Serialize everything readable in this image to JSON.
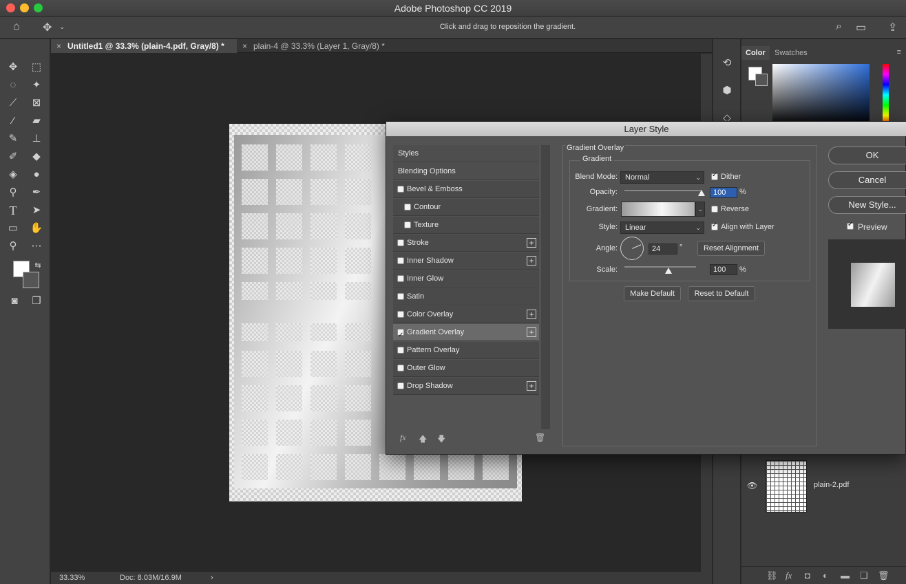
{
  "app": {
    "title": "Adobe Photoshop CC 2019"
  },
  "optionsbar": {
    "hint": "Click and drag to reposition the gradient."
  },
  "tabs": [
    {
      "label": "Untitled1 @ 33.3% (plain-4.pdf, Gray/8) *"
    },
    {
      "label": "plain-4 @ 33.3% (Layer 1, Gray/8) *"
    }
  ],
  "statusbar": {
    "zoom": "33.33%",
    "doc": "Doc: 8.03M/16.9M"
  },
  "color_panel": {
    "tabs": [
      "Color",
      "Swatches"
    ]
  },
  "layers": {
    "layer_name": "plain-2.pdf"
  },
  "dialog": {
    "title": "Layer Style",
    "styles": [
      {
        "label": "Styles",
        "header": true
      },
      {
        "label": "Blending Options",
        "header": true
      },
      {
        "label": "Bevel & Emboss",
        "checked": false
      },
      {
        "label": "Contour",
        "checked": false,
        "indent": true
      },
      {
        "label": "Texture",
        "checked": false,
        "indent": true
      },
      {
        "label": "Stroke",
        "checked": false,
        "plus": true
      },
      {
        "label": "Inner Shadow",
        "checked": false,
        "plus": true
      },
      {
        "label": "Inner Glow",
        "checked": false
      },
      {
        "label": "Satin",
        "checked": false
      },
      {
        "label": "Color Overlay",
        "checked": false,
        "plus": true
      },
      {
        "label": "Gradient Overlay",
        "checked": true,
        "plus": true,
        "selected": true
      },
      {
        "label": "Pattern Overlay",
        "checked": false
      },
      {
        "label": "Outer Glow",
        "checked": false
      },
      {
        "label": "Drop Shadow",
        "checked": false,
        "plus": true
      }
    ],
    "fx_label": "fx",
    "section_title": "Gradient Overlay",
    "group_title": "Gradient",
    "blend_mode_label": "Blend Mode:",
    "blend_mode": "Normal",
    "dither_label": "Dither",
    "dither": true,
    "opacity_label": "Opacity:",
    "opacity": "100",
    "opacity_level": 100,
    "percent": "%",
    "gradient_label": "Gradient:",
    "reverse_label": "Reverse",
    "reverse": false,
    "style_label": "Style:",
    "style": "Linear",
    "align_label": "Align with Layer",
    "align": true,
    "angle_label": "Angle:",
    "angle": "24",
    "degree": "°",
    "reset_alignment": "Reset Alignment",
    "scale_label": "Scale:",
    "scale": "100",
    "make_default": "Make Default",
    "reset_default": "Reset to Default",
    "ok": "OK",
    "cancel": "Cancel",
    "new_style": "New Style...",
    "preview_label": "Preview",
    "preview": true
  }
}
